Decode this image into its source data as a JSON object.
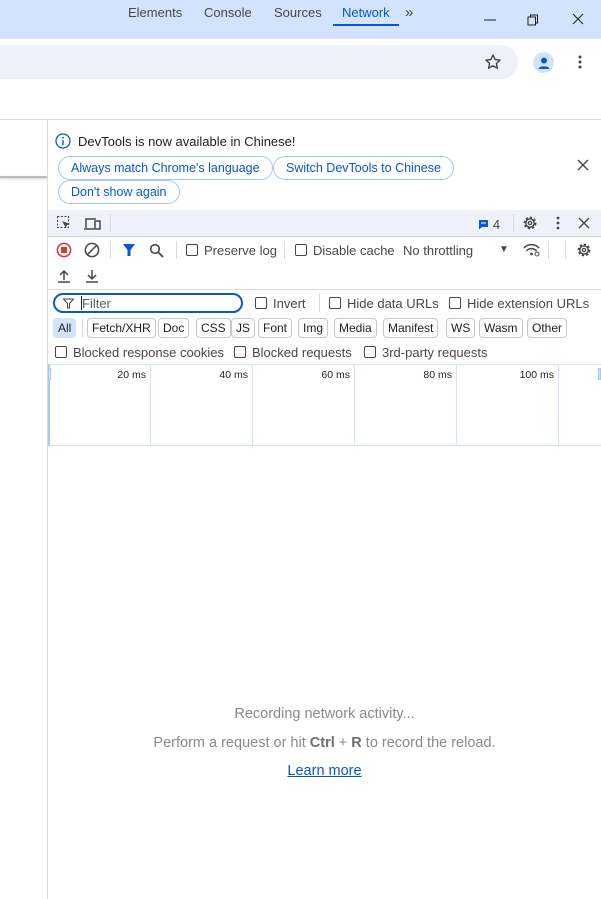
{
  "window": {
    "controls": [
      "minimize-icon",
      "restore-icon",
      "close-icon"
    ]
  },
  "toolbar": {
    "icons": [
      "star-icon",
      "profile-avatar-icon",
      "more-menu-icon"
    ]
  },
  "infobar": {
    "message": "DevTools is now available in Chinese!",
    "buttons": {
      "match": "Always match Chrome's language",
      "switch": "Switch DevTools to Chinese",
      "dismiss": "Don't show again"
    }
  },
  "tabs": {
    "items": [
      "Elements",
      "Console",
      "Sources",
      "Network"
    ],
    "active": "Network",
    "issues_count": "4"
  },
  "network_toolbar": {
    "preserve_log": "Preserve log",
    "disable_cache": "Disable cache",
    "throttling": "No throttling",
    "preserve_log_checked": false,
    "disable_cache_checked": false
  },
  "filter": {
    "placeholder": "Filter",
    "invert": "Invert",
    "hide_data_urls": "Hide data URLs",
    "hide_extension_urls": "Hide extension URLs"
  },
  "types": [
    "All",
    "Fetch/XHR",
    "Doc",
    "CSS",
    "JS",
    "Font",
    "Img",
    "Media",
    "Manifest",
    "WS",
    "Wasm",
    "Other"
  ],
  "types_active": "All",
  "blocked": {
    "cookies": "Blocked response cookies",
    "requests": "Blocked requests",
    "third_party": "3rd-party requests"
  },
  "timeline": {
    "ticks": [
      "20 ms",
      "40 ms",
      "60 ms",
      "80 ms",
      "100 ms"
    ]
  },
  "empty_state": {
    "title": "Recording network activity...",
    "hint_pre": "Perform a request or hit ",
    "key1": "Ctrl",
    "plus": " + ",
    "key2": "R",
    "hint_post": " to record the reload.",
    "link": "Learn more"
  },
  "colors": {
    "accent": "#0b57d0",
    "titlebar": "#d3e3fd",
    "record": "#dc362e"
  }
}
